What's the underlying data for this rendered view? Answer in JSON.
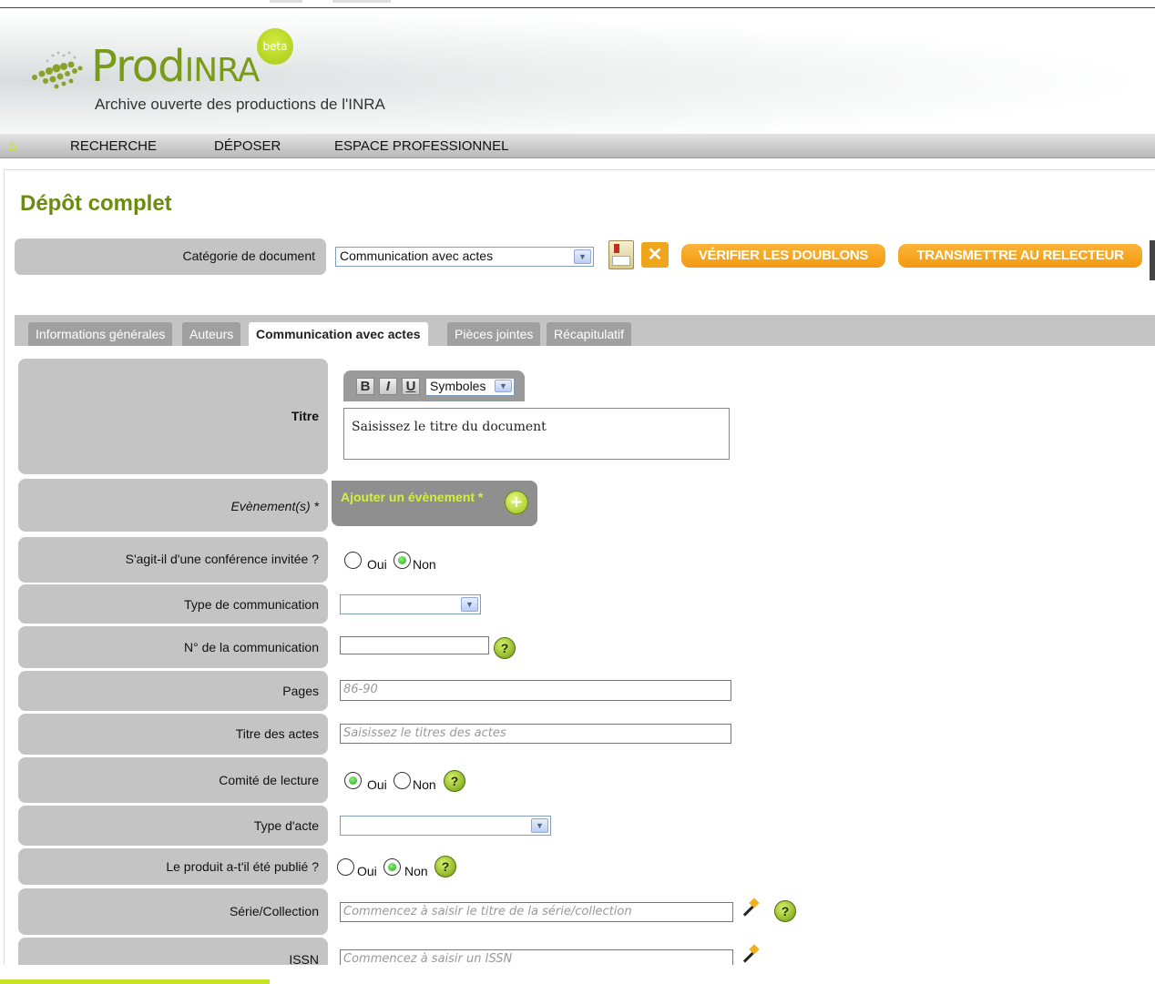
{
  "app": {
    "logo_prod": "Prod",
    "logo_inra": "INRA",
    "beta": "beta",
    "tagline": "Archive ouverte des productions de l'INRA"
  },
  "nav": {
    "home_icon": "home-icon",
    "items": [
      "RECHERCHE",
      "DÉPOSER",
      "ESPACE PROFESSIONNEL"
    ]
  },
  "page": {
    "title": "Dépôt complet"
  },
  "category": {
    "label": "Catégorie de document",
    "value": "Communication avec actes",
    "save_icon": "save-icon",
    "close_icon": "close-icon",
    "check_duplicates": "VÉRIFIER LES DOUBLONS",
    "transmit": "TRANSMETTRE AU RELECTEUR"
  },
  "tabs": [
    {
      "label": "Informations générales",
      "active": false
    },
    {
      "label": "Auteurs",
      "active": false
    },
    {
      "label": "Communication avec actes",
      "active": true
    },
    {
      "label": "Pièces jointes",
      "active": false
    },
    {
      "label": "Récapitulatif",
      "active": false
    }
  ],
  "form": {
    "titre": {
      "label": "Titre",
      "bold": "B",
      "italic": "I",
      "underline": "U",
      "symbols": "Symboles",
      "placeholder": "Saisissez le titre du document"
    },
    "evenements": {
      "label": "Evènement(s) *",
      "button": "Ajouter un évènement *"
    },
    "conference_invitee": {
      "label": "S'agit-il d'une conférence invitée ?",
      "oui": "Oui",
      "non": "Non",
      "selected": "Non"
    },
    "type_communication": {
      "label": "Type de communication",
      "value": ""
    },
    "numero_communication": {
      "label": "N° de la communication",
      "value": ""
    },
    "pages": {
      "label": "Pages",
      "placeholder": "86-90"
    },
    "titre_actes": {
      "label": "Titre des actes",
      "placeholder": "Saisissez le titres des actes"
    },
    "comite_lecture": {
      "label": "Comité de lecture",
      "oui": "Oui",
      "non": "Non",
      "selected": "Oui"
    },
    "type_acte": {
      "label": "Type d'acte",
      "value": ""
    },
    "publie": {
      "label": "Le produit a-t'il été publié ?",
      "oui": "Oui",
      "non": "Non",
      "selected": "Non"
    },
    "serie": {
      "label": "Série/Collection",
      "placeholder": "Commencez à saisir le titre de la série/collection"
    },
    "issn": {
      "label": "ISSN",
      "placeholder": "Commencez à saisir un ISSN"
    }
  },
  "colors": {
    "brand_green": "#6a8c10",
    "accent_orange": "#f29a10",
    "lime": "#d4f03a"
  }
}
